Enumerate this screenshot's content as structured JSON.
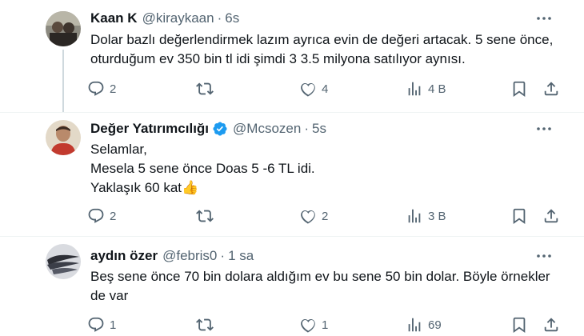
{
  "tweets": [
    {
      "name": "Kaan K",
      "verified": false,
      "handle": "@kiraykaan",
      "separator": "·",
      "time": "6s",
      "lines": [
        "Dolar bazlı değerlendirmek lazım ayrıca evin de değeri artacak. 5 sene önce,",
        "oturduğum ev 350 bin tl idi şimdi 3 3.5 milyona satılıyor aynısı."
      ],
      "counts": {
        "replies": "2",
        "retweets": "",
        "likes": "4",
        "views": "4 B"
      }
    },
    {
      "name": "Değer Yatırımcılığı",
      "verified": true,
      "handle": "@Mcsozen",
      "separator": "·",
      "time": "5s",
      "lines": [
        "Selamlar,",
        "Mesela 5 sene önce Doas 5 -6 TL idi.",
        "Yaklaşık 60 kat"
      ],
      "emoji": "👍",
      "counts": {
        "replies": "2",
        "retweets": "",
        "likes": "2",
        "views": "3 B"
      }
    },
    {
      "name": "aydın özer",
      "verified": false,
      "handle": "@febris0",
      "separator": "·",
      "time": "1 sa",
      "lines": [
        "Beş sene önce 70 bin dolara aldığım ev bu sene 50 bin dolar. Böyle örnekler",
        "de var"
      ],
      "counts": {
        "replies": "1",
        "retweets": "",
        "likes": "1",
        "views": "69"
      }
    }
  ],
  "icons": {
    "more": "more-horizontal-icon",
    "reply": "reply-bubble-icon",
    "retweet": "retweet-icon",
    "like": "heart-icon",
    "views": "views-bar-chart-icon",
    "bookmark": "bookmark-icon",
    "share": "share-icon",
    "verified": "verified-badge-icon"
  },
  "colors": {
    "text": "#0f1419",
    "secondary": "#536471",
    "verified": "#1d9bf0",
    "divider": "#eff3f4",
    "thread_line": "#cfd9de"
  }
}
